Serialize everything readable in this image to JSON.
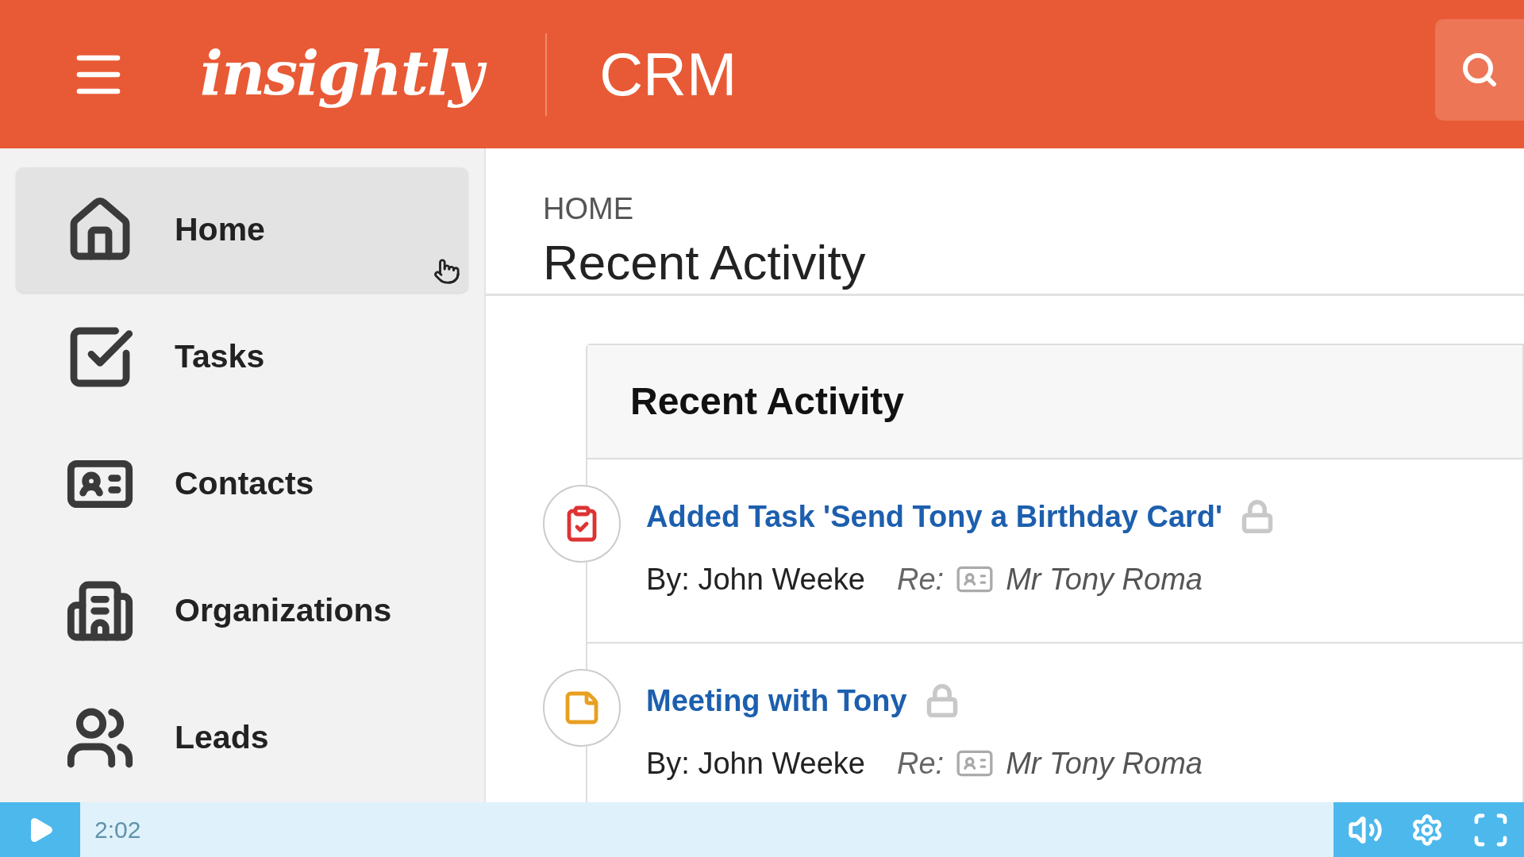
{
  "header": {
    "logo": "insightly",
    "title": "CRM"
  },
  "sidebar": {
    "items": [
      {
        "kind": "home",
        "label": "Home",
        "selected": true
      },
      {
        "kind": "tasks",
        "label": "Tasks",
        "selected": false
      },
      {
        "kind": "contacts",
        "label": "Contacts",
        "selected": false
      },
      {
        "kind": "organizations",
        "label": "Organizations",
        "selected": false
      },
      {
        "kind": "leads",
        "label": "Leads",
        "selected": false
      }
    ]
  },
  "page": {
    "breadcrumb": "HOME",
    "title": "Recent Activity"
  },
  "card": {
    "title": "Recent Activity",
    "items": [
      {
        "kind": "task",
        "title": "Added Task 'Send Tony a Birthday Card'",
        "by": "By: John Weeke",
        "re_label": "Re:",
        "re": "Mr Tony Roma"
      },
      {
        "kind": "event",
        "title": "Meeting with Tony",
        "by": "By: John Weeke",
        "re_label": "Re:",
        "re": "Mr Tony Roma"
      }
    ]
  },
  "player": {
    "time": "2:02"
  }
}
